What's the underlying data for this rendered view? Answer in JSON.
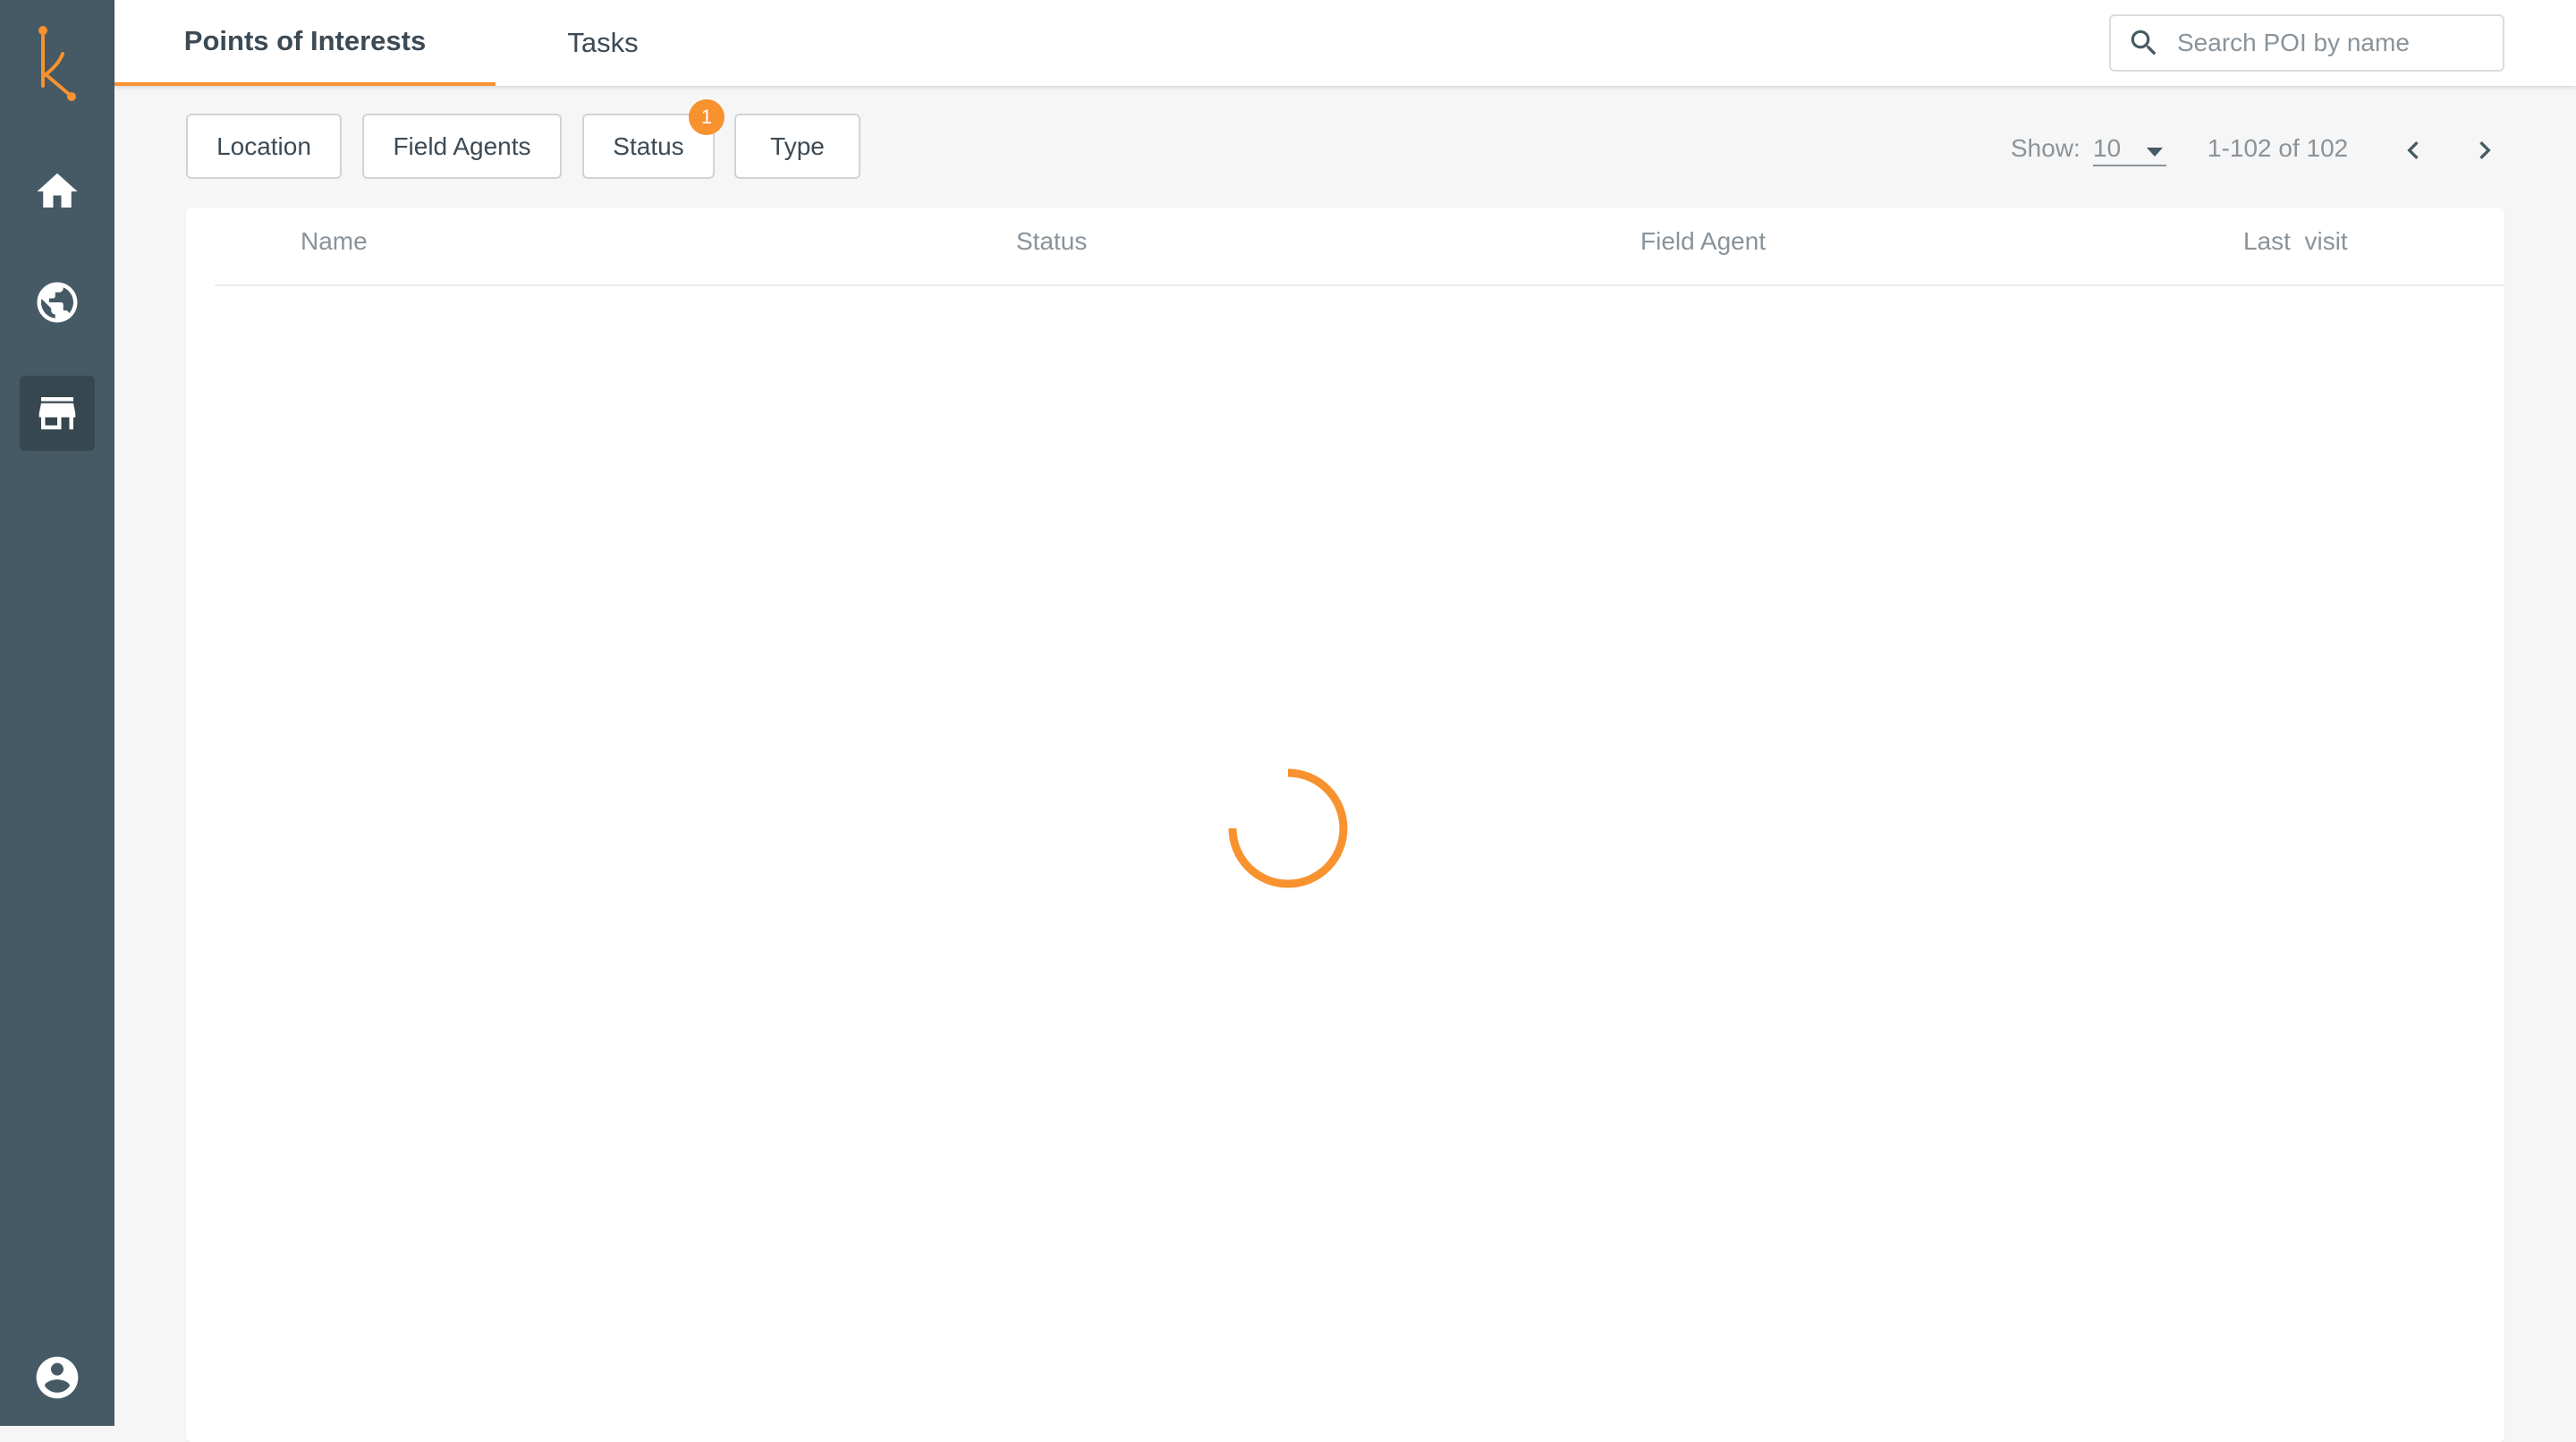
{
  "colors": {
    "sidebar": "#455a64",
    "accent": "#f7922f",
    "background": "#f6f6f6"
  },
  "sidebar": {
    "items": [
      {
        "icon": "home-icon"
      },
      {
        "icon": "globe-icon"
      },
      {
        "icon": "store-icon",
        "active": true
      }
    ],
    "account_icon": "account-circle-icon"
  },
  "tabs": [
    {
      "label": "Points of Interests",
      "active": true
    },
    {
      "label": "Tasks",
      "active": false
    }
  ],
  "search": {
    "placeholder": "Search POI by name"
  },
  "filters": [
    {
      "label": "Location"
    },
    {
      "label": "Field Agents"
    },
    {
      "label": "Status",
      "badge": "1"
    },
    {
      "label": "Type"
    }
  ],
  "pagination": {
    "show_label": "Show:",
    "page_size": "10",
    "range": "1-102 of 102"
  },
  "table": {
    "columns": [
      "Name",
      "Status",
      "Field Agent",
      "Last  visit"
    ],
    "rows": [],
    "loading": true
  }
}
